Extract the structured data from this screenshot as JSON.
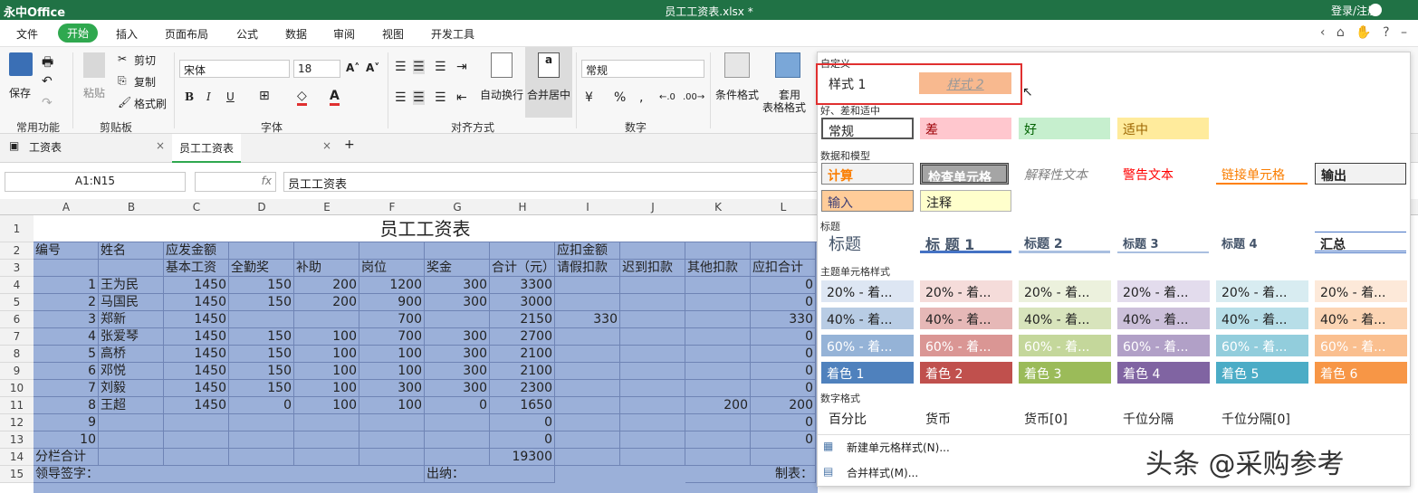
{
  "app": {
    "logo": "永中Office",
    "document_title": "员工工资表.xlsx *",
    "login": "登录/注册"
  },
  "menu": [
    "文件",
    "开始",
    "插入",
    "页面布局",
    "公式",
    "数据",
    "审阅",
    "视图",
    "开发工具"
  ],
  "ribbon": {
    "groups": [
      "常用功能",
      "剪贴板",
      "字体",
      "对齐方式",
      "数字"
    ],
    "save": "保存",
    "paste": "粘贴",
    "cut": "剪切",
    "copy": "复制",
    "format_brush": "格式刷",
    "font_name": "宋体",
    "font_size": "18",
    "bold": "B",
    "italic": "I",
    "underline": "U",
    "wrap": "自动换行",
    "merge": "合并居中",
    "number_format": "常规",
    "cond_format": "条件格式",
    "apply_table": "套用",
    "table_format": "表格格式"
  },
  "sheet_tabs": [
    "工资表",
    "员工工资表"
  ],
  "formula_bar": {
    "cell_ref": "A1:N15",
    "fx": "fx",
    "content": "员工工资表"
  },
  "columns": [
    "A",
    "B",
    "C",
    "D",
    "E",
    "F",
    "G",
    "H",
    "I",
    "J",
    "K",
    "L"
  ],
  "rows": [
    "1",
    "2",
    "3",
    "4",
    "5",
    "6",
    "7",
    "8",
    "9",
    "10",
    "11",
    "12",
    "13",
    "14",
    "15"
  ],
  "table": {
    "title": "员工工资表",
    "row2": [
      "编号",
      "姓名",
      "应发金额",
      "",
      "",
      "",
      "",
      "",
      "应扣金额",
      "",
      "",
      ""
    ],
    "row3": [
      "",
      "",
      "基本工资",
      "全勤奖",
      "补助",
      "岗位",
      "奖金",
      "合计（元）",
      "请假扣款",
      "迟到扣款",
      "其他扣款",
      "应扣合计"
    ],
    "data": [
      [
        "1",
        "王为民",
        "1450",
        "150",
        "200",
        "1200",
        "300",
        "3300",
        "",
        "",
        "",
        "0"
      ],
      [
        "2",
        "马国民",
        "1450",
        "150",
        "200",
        "900",
        "300",
        "3000",
        "",
        "",
        "",
        "0"
      ],
      [
        "3",
        "郑新",
        "1450",
        "",
        "",
        "700",
        "",
        "2150",
        "330",
        "",
        "",
        "330"
      ],
      [
        "4",
        "张爱琴",
        "1450",
        "150",
        "100",
        "700",
        "300",
        "2700",
        "",
        "",
        "",
        "0"
      ],
      [
        "5",
        "高桥",
        "1450",
        "150",
        "100",
        "100",
        "300",
        "2100",
        "",
        "",
        "",
        "0"
      ],
      [
        "6",
        "邓悦",
        "1450",
        "150",
        "100",
        "100",
        "300",
        "2100",
        "",
        "",
        "",
        "0"
      ],
      [
        "7",
        "刘毅",
        "1450",
        "150",
        "100",
        "300",
        "300",
        "2300",
        "",
        "",
        "",
        "0"
      ],
      [
        "8",
        "王超",
        "1450",
        "0",
        "100",
        "100",
        "0",
        "1650",
        "",
        "",
        "200",
        "200"
      ],
      [
        "9",
        "",
        "",
        "",
        "",
        "",
        "",
        "0",
        "",
        "",
        "",
        "0"
      ],
      [
        "10",
        "",
        "",
        "",
        "",
        "",
        "",
        "0",
        "",
        "",
        "",
        "0"
      ]
    ],
    "row14": [
      "分栏合计",
      "",
      "",
      "",
      "",
      "",
      "",
      "19300",
      "",
      "",
      "",
      ""
    ],
    "row15_left": "领导签字：",
    "row15_mid": "出纳：",
    "row15_right": "制表："
  },
  "styles_panel": {
    "custom_label": "自定义",
    "custom": [
      "样式 1",
      "样式 2"
    ],
    "good_bad_label": "好、差和适中",
    "good_bad": [
      "常规",
      "差",
      "好",
      "适中"
    ],
    "data_model_label": "数据和模型",
    "data_model": [
      "计算",
      "检查单元格",
      "解释性文本",
      "警告文本",
      "链接单元格",
      "输出",
      "输入",
      "注释"
    ],
    "headings_label": "标题",
    "headings": [
      "标题",
      "标 题 1",
      "标题 2",
      "标题 3",
      "标题 4",
      "汇总"
    ],
    "theme_label": "主题单元格样式",
    "theme_20": [
      "20% - 着...",
      "20% - 着...",
      "20% - 着...",
      "20% - 着...",
      "20% - 着...",
      "20% - 着..."
    ],
    "theme_40": [
      "40% - 着...",
      "40% - 着...",
      "40% - 着...",
      "40% - 着...",
      "40% - 着...",
      "40% - 着..."
    ],
    "theme_60": [
      "60% - 着...",
      "60% - 着...",
      "60% - 着...",
      "60% - 着...",
      "60% - 着...",
      "60% - 着..."
    ],
    "accents": [
      "着色 1",
      "着色 2",
      "着色 3",
      "着色 4",
      "着色 5",
      "着色 6"
    ],
    "number_label": "数字格式",
    "number_formats": [
      "百分比",
      "货币",
      "货币[0]",
      "千位分隔",
      "千位分隔[0]"
    ],
    "new_style": "新建单元格样式(N)...",
    "merge_style": "合并样式(M)..."
  },
  "watermark": "头条 @采购参考"
}
